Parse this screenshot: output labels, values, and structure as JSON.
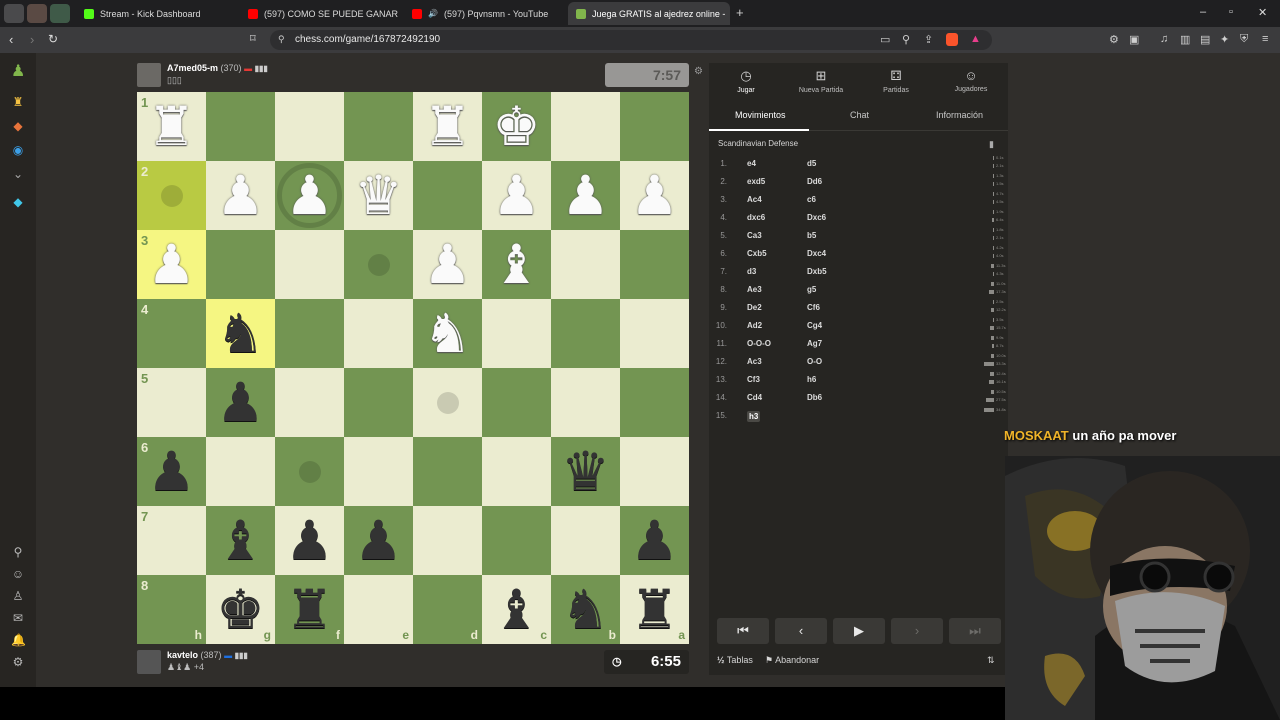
{
  "browser": {
    "tabs": [
      {
        "title": "Stream - Kick Dashboard",
        "active": false
      },
      {
        "title": "(597) COMO SE PUEDE GANAR CON",
        "active": false
      },
      {
        "title": "(597) Pqvnsmn - YouTube",
        "active": false
      },
      {
        "title": "Juega GRATIS al ajedrez online -",
        "active": true
      }
    ],
    "url": "chess.com/game/167872492190",
    "colors": {
      "kick": "#53fc18",
      "youtube": "#ff0000",
      "chess": "#81b64c"
    }
  },
  "top_player": {
    "name": "A7med05-m",
    "rating": "(370)",
    "clock": "7:57"
  },
  "bottom_player": {
    "name": "kavtelo",
    "rating": "(387)",
    "material": "+4",
    "clock": "6:55"
  },
  "board": {
    "orientation": "black",
    "ranks": [
      "1",
      "2",
      "3",
      "4",
      "5",
      "6",
      "7",
      "8"
    ],
    "files": [
      "h",
      "g",
      "f",
      "e",
      "d",
      "c",
      "b",
      "a"
    ],
    "pieces": {
      "h1": "wR",
      "d1": "wR",
      "c1": "wK",
      "g2": "wP",
      "f2": "wP",
      "e2": "wQ",
      "c2": "wP",
      "b2": "wP",
      "a2": "wP",
      "h3": "wP",
      "d3": "wP",
      "c3": "wB",
      "g4": "bN",
      "d4": "wN",
      "g5": "bP",
      "h6": "bP",
      "b6": "bQ",
      "g7": "bB",
      "f7": "bP",
      "e7": "bP",
      "a7": "bP",
      "g8": "bK",
      "f8": "bR",
      "c8": "bB",
      "b8": "bN",
      "a8": "bR"
    },
    "highlights": [
      "h2",
      "h3",
      "g4"
    ],
    "hint_dots": [
      "h2",
      "e3",
      "d5",
      "f6"
    ],
    "hint_rings": [
      "f2"
    ]
  },
  "panel": {
    "tabs": [
      {
        "label": "Jugar",
        "icon": "timer-icon"
      },
      {
        "label": "Nueva Partida",
        "icon": "plus-icon"
      },
      {
        "label": "Partidas",
        "icon": "dice-icon"
      },
      {
        "label": "Jugadores",
        "icon": "users-icon"
      }
    ],
    "subtabs": [
      "Movimientos",
      "Chat",
      "Información"
    ],
    "opening": "Scandinavian Defense",
    "moves": [
      {
        "n": "1.",
        "w": "e4",
        "b": "d5",
        "wt": "0.1s",
        "bt": "2.1s",
        "wv": 0.1,
        "bv": 2.1
      },
      {
        "n": "2.",
        "w": "exd5",
        "b": "Dd6",
        "wt": "1.3s",
        "bt": "1.5s",
        "wv": 1.3,
        "bv": 1.5
      },
      {
        "n": "3.",
        "w": "Ac4",
        "b": "c6",
        "wt": "4.7s",
        "bt": "4.5s",
        "wv": 4.7,
        "bv": 4.5
      },
      {
        "n": "4.",
        "w": "dxc6",
        "b": "Dxc6",
        "wt": "1.9s",
        "bt": "6.4s",
        "wv": 1.9,
        "bv": 6.4
      },
      {
        "n": "5.",
        "w": "Ca3",
        "b": "b5",
        "wt": "1.8s",
        "bt": "2.1s",
        "wv": 1.8,
        "bv": 2.1
      },
      {
        "n": "6.",
        "w": "Cxb5",
        "b": "Dxc4",
        "wt": "4.2s",
        "bt": "4.0s",
        "wv": 4.2,
        "bv": 4.0
      },
      {
        "n": "7.",
        "w": "d3",
        "b": "Dxb5",
        "wt": "11.3s",
        "bt": "4.3s",
        "wv": 11.3,
        "bv": 4.3
      },
      {
        "n": "8.",
        "w": "Ae3",
        "b": "g5",
        "wt": "11.0s",
        "bt": "17.3s",
        "wv": 11.0,
        "bv": 17.3
      },
      {
        "n": "9.",
        "w": "De2",
        "b": "Cf6",
        "wt": "2.5s",
        "bt": "12.2s",
        "wv": 2.5,
        "bv": 12.2
      },
      {
        "n": "10.",
        "w": "Ad2",
        "b": "Cg4",
        "wt": "3.5s",
        "bt": "15.7s",
        "wv": 3.5,
        "bv": 15.7
      },
      {
        "n": "11.",
        "w": "O-O-O",
        "b": "Ag7",
        "wt": "9.9s",
        "bt": "8.7s",
        "wv": 9.9,
        "bv": 8.7
      },
      {
        "n": "12.",
        "w": "Ac3",
        "b": "O-O",
        "wt": "10.0s",
        "bt": "33.3s",
        "wv": 10.0,
        "bv": 33.3
      },
      {
        "n": "13.",
        "w": "Cf3",
        "b": "h6",
        "wt": "12.4s",
        "bt": "16.1s",
        "wv": 12.4,
        "bv": 16.1
      },
      {
        "n": "14.",
        "w": "Cd4",
        "b": "Db6",
        "wt": "10.5s",
        "bt": "27.5s",
        "wv": 10.5,
        "bv": 27.5
      },
      {
        "n": "15.",
        "w": "h3",
        "b": "",
        "wt": "34.8s",
        "bt": "",
        "wv": 34.8,
        "bv": 0
      }
    ],
    "draw_label": "Tablas",
    "draw_prefix": "½",
    "resign_label": "Abandonar"
  },
  "stream": {
    "name": "MOSKAAT",
    "message": "un año pa mover"
  }
}
